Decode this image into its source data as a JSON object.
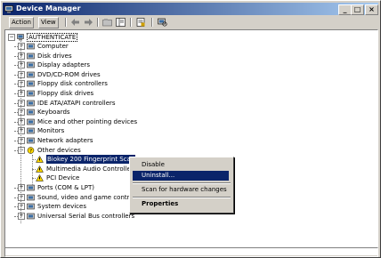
{
  "window": {
    "title": "Device Manager",
    "minimize": "_",
    "maximize": "□",
    "close": "×"
  },
  "menubar": {
    "action": "Action",
    "view": "View"
  },
  "tree": {
    "root": "AUTHENTICATE",
    "items": [
      "Computer",
      "Disk drives",
      "Display adapters",
      "DVD/CD-ROM drives",
      "Floppy disk controllers",
      "Floppy disk drives",
      "IDE ATA/ATAPI controllers",
      "Keyboards",
      "Mice and other pointing devices",
      "Monitors",
      "Network adapters",
      "Other devices"
    ],
    "other_children": [
      "Biokey 200 Fingerprint Scan",
      "Multimedia Audio Controller",
      "PCI Device"
    ],
    "after": [
      "Ports (COM & LPT)",
      "Sound, video and game controllers",
      "System devices",
      "Universal Serial Bus controllers"
    ]
  },
  "context_menu": {
    "disable": "Disable",
    "uninstall": "Uninstall...",
    "scan": "Scan for hardware changes",
    "properties": "Properties"
  }
}
